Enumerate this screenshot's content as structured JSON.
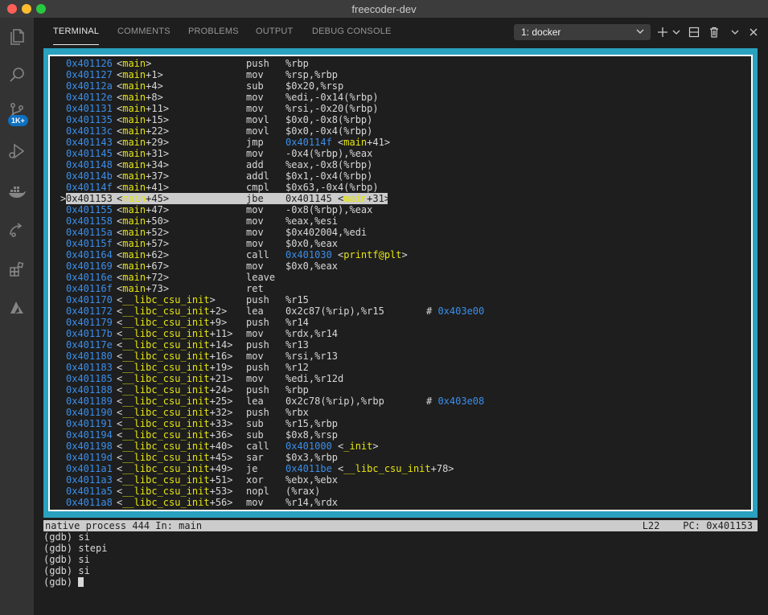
{
  "window": {
    "title": "freecoder-dev"
  },
  "activity_bar": {
    "items": [
      {
        "icon": "files-icon"
      },
      {
        "icon": "search-icon"
      },
      {
        "icon": "source-control-icon",
        "badge": "1K+"
      },
      {
        "icon": "run-debug-icon"
      },
      {
        "icon": "docker-icon"
      },
      {
        "icon": "remote-explorer-icon"
      },
      {
        "icon": "extensions-icon"
      },
      {
        "icon": "azure-icon"
      }
    ]
  },
  "panel": {
    "tabs": [
      "TERMINAL",
      "COMMENTS",
      "PROBLEMS",
      "OUTPUT",
      "DEBUG CONSOLE"
    ],
    "active_tab": "TERMINAL",
    "terminal_select": "1: docker",
    "actions": [
      "add-terminal-icon",
      "chevron-down-icon",
      "split-terminal-icon",
      "trash-icon",
      "maximize-icon",
      "close-icon"
    ]
  },
  "disassembly": [
    {
      "addr": "0x401126",
      "sym": "<main>",
      "fn": "main",
      "off": "",
      "op": "push",
      "args": "%rbp"
    },
    {
      "addr": "0x401127",
      "sym": "<main+1>",
      "fn": "main",
      "off": "+1",
      "op": "mov",
      "args": "%rsp,%rbp"
    },
    {
      "addr": "0x40112a",
      "sym": "<main+4>",
      "fn": "main",
      "off": "+4",
      "op": "sub",
      "args": "$0x20,%rsp"
    },
    {
      "addr": "0x40112e",
      "sym": "<main+8>",
      "fn": "main",
      "off": "+8",
      "op": "mov",
      "args": "%edi,-0x14(%rbp)"
    },
    {
      "addr": "0x401131",
      "sym": "<main+11>",
      "fn": "main",
      "off": "+11",
      "op": "mov",
      "args": "%rsi,-0x20(%rbp)"
    },
    {
      "addr": "0x401135",
      "sym": "<main+15>",
      "fn": "main",
      "off": "+15",
      "op": "movl",
      "args": "$0x0,-0x8(%rbp)"
    },
    {
      "addr": "0x40113c",
      "sym": "<main+22>",
      "fn": "main",
      "off": "+22",
      "op": "movl",
      "args": "$0x0,-0x4(%rbp)"
    },
    {
      "addr": "0x401143",
      "sym": "<main+29>",
      "fn": "main",
      "off": "+29",
      "op": "jmp",
      "args": "",
      "target": "0x40114f",
      "target_fn": "main",
      "target_off": "+41"
    },
    {
      "addr": "0x401145",
      "sym": "<main+31>",
      "fn": "main",
      "off": "+31",
      "op": "mov",
      "args": "-0x4(%rbp),%eax"
    },
    {
      "addr": "0x401148",
      "sym": "<main+34>",
      "fn": "main",
      "off": "+34",
      "op": "add",
      "args": "%eax,-0x8(%rbp)"
    },
    {
      "addr": "0x40114b",
      "sym": "<main+37>",
      "fn": "main",
      "off": "+37",
      "op": "addl",
      "args": "$0x1,-0x4(%rbp)"
    },
    {
      "addr": "0x40114f",
      "sym": "<main+41>",
      "fn": "main",
      "off": "+41",
      "op": "cmpl",
      "args": "$0x63,-0x4(%rbp)"
    },
    {
      "addr": "0x401153",
      "sym": "<main+45>",
      "fn": "main",
      "off": "+45",
      "op": "jbe",
      "args": "",
      "target": "0x401145",
      "target_fn": "main",
      "target_off": "+31",
      "current": true
    },
    {
      "addr": "0x401155",
      "sym": "<main+47>",
      "fn": "main",
      "off": "+47",
      "op": "mov",
      "args": "-0x8(%rbp),%eax"
    },
    {
      "addr": "0x401158",
      "sym": "<main+50>",
      "fn": "main",
      "off": "+50",
      "op": "mov",
      "args": "%eax,%esi"
    },
    {
      "addr": "0x40115a",
      "sym": "<main+52>",
      "fn": "main",
      "off": "+52",
      "op": "mov",
      "args": "$0x402004,%edi"
    },
    {
      "addr": "0x40115f",
      "sym": "<main+57>",
      "fn": "main",
      "off": "+57",
      "op": "mov",
      "args": "$0x0,%eax"
    },
    {
      "addr": "0x401164",
      "sym": "<main+62>",
      "fn": "main",
      "off": "+62",
      "op": "call",
      "args": "",
      "target": "0x401030",
      "target_fn": "printf@plt",
      "target_off": ""
    },
    {
      "addr": "0x401169",
      "sym": "<main+67>",
      "fn": "main",
      "off": "+67",
      "op": "mov",
      "args": "$0x0,%eax"
    },
    {
      "addr": "0x40116e",
      "sym": "<main+72>",
      "fn": "main",
      "off": "+72",
      "op": "leave",
      "args": ""
    },
    {
      "addr": "0x40116f",
      "sym": "<main+73>",
      "fn": "main",
      "off": "+73",
      "op": "ret",
      "args": ""
    },
    {
      "addr": "0x401170",
      "sym": "<__libc_csu_init>",
      "fn": "__libc_csu_init",
      "off": "",
      "op": "push",
      "args": "%r15"
    },
    {
      "addr": "0x401172",
      "sym": "<__libc_csu_init+2>",
      "fn": "__libc_csu_init",
      "off": "+2",
      "op": "lea",
      "args": "0x2c87(%rip),%r15",
      "comment": "0x403e00"
    },
    {
      "addr": "0x401179",
      "sym": "<__libc_csu_init+9>",
      "fn": "__libc_csu_init",
      "off": "+9",
      "op": "push",
      "args": "%r14"
    },
    {
      "addr": "0x40117b",
      "sym": "<__libc_csu_init+11>",
      "fn": "__libc_csu_init",
      "off": "+11",
      "op": "mov",
      "args": "%rdx,%r14"
    },
    {
      "addr": "0x40117e",
      "sym": "<__libc_csu_init+14>",
      "fn": "__libc_csu_init",
      "off": "+14",
      "op": "push",
      "args": "%r13"
    },
    {
      "addr": "0x401180",
      "sym": "<__libc_csu_init+16>",
      "fn": "__libc_csu_init",
      "off": "+16",
      "op": "mov",
      "args": "%rsi,%r13"
    },
    {
      "addr": "0x401183",
      "sym": "<__libc_csu_init+19>",
      "fn": "__libc_csu_init",
      "off": "+19",
      "op": "push",
      "args": "%r12"
    },
    {
      "addr": "0x401185",
      "sym": "<__libc_csu_init+21>",
      "fn": "__libc_csu_init",
      "off": "+21",
      "op": "mov",
      "args": "%edi,%r12d"
    },
    {
      "addr": "0x401188",
      "sym": "<__libc_csu_init+24>",
      "fn": "__libc_csu_init",
      "off": "+24",
      "op": "push",
      "args": "%rbp"
    },
    {
      "addr": "0x401189",
      "sym": "<__libc_csu_init+25>",
      "fn": "__libc_csu_init",
      "off": "+25",
      "op": "lea",
      "args": "0x2c78(%rip),%rbp",
      "comment": "0x403e08"
    },
    {
      "addr": "0x401190",
      "sym": "<__libc_csu_init+32>",
      "fn": "__libc_csu_init",
      "off": "+32",
      "op": "push",
      "args": "%rbx"
    },
    {
      "addr": "0x401191",
      "sym": "<__libc_csu_init+33>",
      "fn": "__libc_csu_init",
      "off": "+33",
      "op": "sub",
      "args": "%r15,%rbp"
    },
    {
      "addr": "0x401194",
      "sym": "<__libc_csu_init+36>",
      "fn": "__libc_csu_init",
      "off": "+36",
      "op": "sub",
      "args": "$0x8,%rsp"
    },
    {
      "addr": "0x401198",
      "sym": "<__libc_csu_init+40>",
      "fn": "__libc_csu_init",
      "off": "+40",
      "op": "call",
      "args": "",
      "target": "0x401000",
      "target_fn": "_init",
      "target_off": ""
    },
    {
      "addr": "0x40119d",
      "sym": "<__libc_csu_init+45>",
      "fn": "__libc_csu_init",
      "off": "+45",
      "op": "sar",
      "args": "$0x3,%rbp"
    },
    {
      "addr": "0x4011a1",
      "sym": "<__libc_csu_init+49>",
      "fn": "__libc_csu_init",
      "off": "+49",
      "op": "je",
      "args": "",
      "target": "0x4011be",
      "target_fn": "__libc_csu_init",
      "target_off": "+78"
    },
    {
      "addr": "0x4011a3",
      "sym": "<__libc_csu_init+51>",
      "fn": "__libc_csu_init",
      "off": "+51",
      "op": "xor",
      "args": "%ebx,%ebx"
    },
    {
      "addr": "0x4011a5",
      "sym": "<__libc_csu_init+53>",
      "fn": "__libc_csu_init",
      "off": "+53",
      "op": "nopl",
      "args": "(%rax)"
    },
    {
      "addr": "0x4011a8",
      "sym": "<__libc_csu_init+56>",
      "fn": "__libc_csu_init",
      "off": "+56",
      "op": "mov",
      "args": "%r14,%rdx"
    }
  ],
  "status": {
    "left": "native process 444 In: main",
    "line": "L22",
    "pc": "PC: 0x401153"
  },
  "gdb_lines": [
    "(gdb) si",
    "(gdb) stepi",
    "(gdb) si",
    "(gdb) si",
    "(gdb) "
  ],
  "colors": {
    "frame": "#2aa1be",
    "address": "#3b8eea",
    "function": "#e5e510"
  }
}
